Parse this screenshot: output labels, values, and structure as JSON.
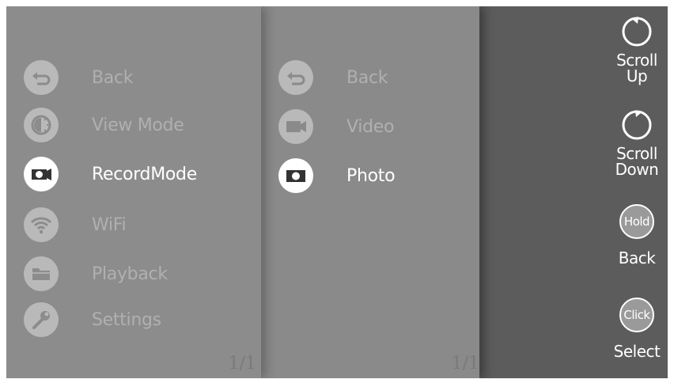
{
  "left_menu": {
    "items": [
      {
        "label": "Back",
        "icon": "back-arrow-icon"
      },
      {
        "label": "View Mode",
        "icon": "view-mode-icon"
      },
      {
        "label": "RecordMode",
        "icon": "camera-record-icon"
      },
      {
        "label": "WiFi",
        "icon": "wifi-icon"
      },
      {
        "label": "Playback",
        "icon": "folder-icon"
      },
      {
        "label": "Settings",
        "icon": "wrench-icon"
      }
    ],
    "active_index": 2,
    "page": "1/1"
  },
  "sub_menu": {
    "items": [
      {
        "label": "Back",
        "icon": "back-arrow-icon"
      },
      {
        "label": "Video",
        "icon": "video-camera-icon"
      },
      {
        "label": "Photo",
        "icon": "photo-camera-icon"
      }
    ],
    "active_index": 2,
    "page": "1/1"
  },
  "controls": {
    "scroll_up": {
      "line1": "Scroll",
      "line2": "Up"
    },
    "scroll_down": {
      "line1": "Scroll",
      "line2": "Down"
    },
    "back": {
      "badge": "Hold",
      "label": "Back"
    },
    "select": {
      "badge": "Click",
      "label": "Select"
    }
  },
  "colors": {
    "panel_left": "#8c8c8c",
    "panel_mid": "#8a8a8a",
    "panel_right": "#5c5c5c",
    "active": "#ffffff",
    "inactive": "#b0b0b0"
  }
}
